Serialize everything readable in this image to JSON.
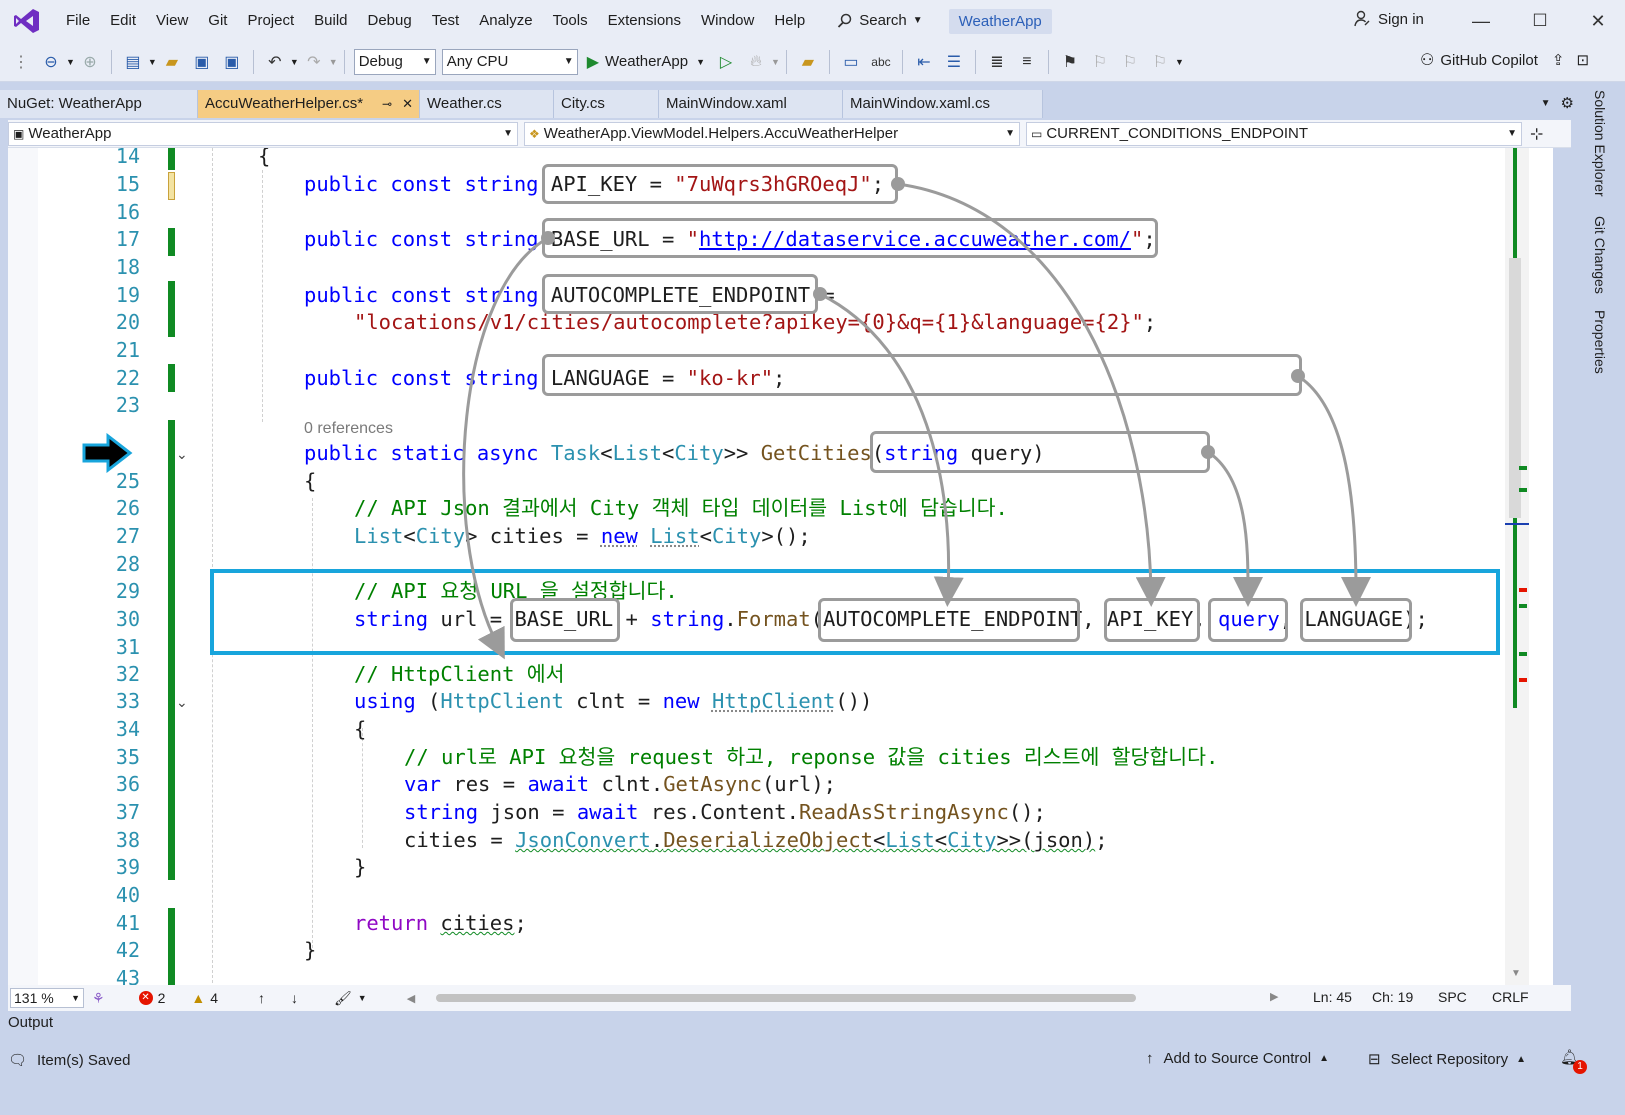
{
  "title_bar": {
    "menus": [
      "File",
      "Edit",
      "View",
      "Git",
      "Project",
      "Build",
      "Debug",
      "Test",
      "Analyze",
      "Tools",
      "Extensions",
      "Window",
      "Help"
    ],
    "search_label": "Search",
    "solution_name": "WeatherApp",
    "sign_in_label": "Sign in"
  },
  "toolbar": {
    "configuration": "Debug",
    "platform": "Any CPU",
    "run_target": "WeatherApp",
    "copilot_label": "GitHub Copilot"
  },
  "tabs": [
    {
      "label": "NuGet: WeatherApp",
      "active": false
    },
    {
      "label": "AccuWeatherHelper.cs*",
      "active": true
    },
    {
      "label": "Weather.cs",
      "active": false
    },
    {
      "label": "City.cs",
      "active": false
    },
    {
      "label": "MainWindow.xaml",
      "active": false
    },
    {
      "label": "MainWindow.xaml.cs",
      "active": false
    }
  ],
  "navbar": {
    "project": "WeatherApp",
    "type": "WeatherApp.ViewModel.Helpers.AccuWeatherHelper",
    "member": "CURRENT_CONDITIONS_ENDPOINT"
  },
  "editor": {
    "codelens": "0 references",
    "line_numbers": [
      "14",
      "15",
      "16",
      "17",
      "18",
      "19",
      "20",
      "21",
      "22",
      "23",
      "",
      "25",
      "26",
      "27",
      "28",
      "29",
      "30",
      "31",
      "32",
      "33",
      "34",
      "35",
      "36",
      "37",
      "38",
      "39",
      "40",
      "41",
      "42",
      "43"
    ]
  },
  "side_tabs": [
    "Solution Explorer",
    "Git Changes",
    "Properties"
  ],
  "editor_footer": {
    "zoom": "131 %",
    "errors": "2",
    "warnings": "4",
    "line": "Ln: 45",
    "column": "Ch: 19",
    "whitespace": "SPC",
    "line_ending": "CRLF"
  },
  "output_label": "Output",
  "status_bar": {
    "message": "Item(s) Saved",
    "add_to_source_control": "Add to Source Control",
    "select_repository": "Select Repository",
    "notification_count": "1"
  },
  "colors": {
    "highlight_box": "#18a5dc",
    "annotation_box": "#9b9b9b",
    "change_bar": "#108a23"
  }
}
